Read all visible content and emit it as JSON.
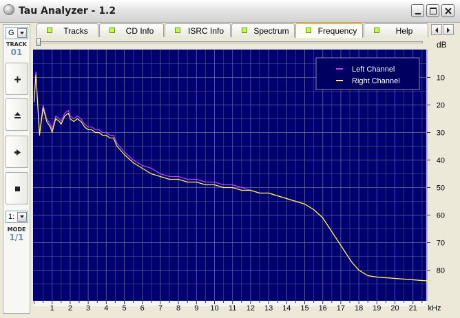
{
  "window": {
    "title": "Tau Analyzer - 1.2"
  },
  "tabs": [
    {
      "label": "Tracks",
      "active": false
    },
    {
      "label": "CD Info",
      "active": false
    },
    {
      "label": "ISRC Info",
      "active": false
    },
    {
      "label": "Spectrum",
      "active": false
    },
    {
      "label": "Frequency",
      "active": true
    },
    {
      "label": "Help",
      "active": false
    }
  ],
  "sidebar": {
    "top_combo_value": "G",
    "track_caption": "TRACK",
    "track_number": "01",
    "mode_combo_value": "1:",
    "mode_caption": "MODE",
    "mode_value": "1/1",
    "buttons": [
      "plus-icon",
      "eject-icon",
      "play-icon",
      "stop-icon"
    ]
  },
  "colors": {
    "plot_bg": "#000070",
    "grid": "#6f6f9a",
    "left_channel": "#c040ff",
    "right_channel": "#ffff40",
    "active_tab_accent": "#f2b338",
    "led": "#c4ff40"
  },
  "chart_data": {
    "type": "line",
    "xlabel": "kHz",
    "ylabel": "dB",
    "x_ticks": [
      1,
      2,
      3,
      4,
      5,
      6,
      7,
      8,
      9,
      10,
      11,
      12,
      13,
      14,
      15,
      16,
      17,
      18,
      19,
      20,
      21
    ],
    "y_ticks": [
      -10,
      -20,
      -30,
      -40,
      -50,
      -60,
      -70,
      -80
    ],
    "y_tick_labels": [
      "10",
      "20",
      "30",
      "40",
      "50",
      "60",
      "70",
      "80"
    ],
    "xlim": [
      0,
      22.05
    ],
    "ylim": [
      -89,
      0
    ],
    "grid": true,
    "legend_position": "top-right",
    "series": [
      {
        "name": "Left Channel",
        "color": "#c040ff",
        "x": [
          0.0,
          0.1,
          0.3,
          0.5,
          0.7,
          0.9,
          1.0,
          1.2,
          1.4,
          1.5,
          1.7,
          1.9,
          2.0,
          2.2,
          2.4,
          2.6,
          2.8,
          3.0,
          3.2,
          3.4,
          3.6,
          3.8,
          4.0,
          4.2,
          4.4,
          4.6,
          5.0,
          5.5,
          6.0,
          6.5,
          7.0,
          7.5,
          8.0,
          8.5,
          9.0,
          9.5,
          10.0,
          10.5,
          11.0,
          11.5,
          12.0,
          12.5,
          13.0,
          13.5,
          14.0,
          14.5,
          15.0,
          15.5,
          16.0,
          16.3,
          16.6,
          17.0,
          17.3,
          17.6,
          18.0,
          18.5,
          19.0,
          20.0,
          21.0,
          22.0
        ],
        "y": [
          -18,
          -8,
          -30,
          -20,
          -25,
          -27,
          -29,
          -24,
          -25,
          -26,
          -23,
          -22,
          -24,
          -25,
          -24,
          -25,
          -27,
          -28,
          -28,
          -29,
          -29,
          -30,
          -30,
          -31,
          -31,
          -34,
          -37,
          -40,
          -42,
          -43,
          -45,
          -46,
          -46,
          -47,
          -47,
          -48,
          -48,
          -49,
          -49,
          -50,
          -51,
          -52,
          -52,
          -53,
          -54,
          -55,
          -56,
          -58,
          -61,
          -64,
          -67,
          -71,
          -74,
          -77,
          -80,
          -82,
          -82.5,
          -83,
          -83.5,
          -84
        ]
      },
      {
        "name": "Right Channel",
        "color": "#ffff40",
        "x": [
          0.0,
          0.1,
          0.3,
          0.5,
          0.7,
          0.9,
          1.0,
          1.2,
          1.4,
          1.5,
          1.7,
          1.9,
          2.0,
          2.2,
          2.4,
          2.6,
          2.8,
          3.0,
          3.2,
          3.4,
          3.6,
          3.8,
          4.0,
          4.2,
          4.4,
          4.6,
          5.0,
          5.5,
          6.0,
          6.5,
          7.0,
          7.5,
          8.0,
          8.5,
          9.0,
          9.5,
          10.0,
          10.5,
          11.0,
          11.5,
          12.0,
          12.5,
          13.0,
          13.5,
          14.0,
          14.5,
          15.0,
          15.5,
          16.0,
          16.3,
          16.6,
          17.0,
          17.3,
          17.6,
          18.0,
          18.5,
          19.0,
          20.0,
          21.0,
          22.0
        ],
        "y": [
          -19,
          -9,
          -31,
          -21,
          -26,
          -28,
          -30,
          -25,
          -26,
          -27,
          -24,
          -23,
          -25,
          -26,
          -25,
          -26,
          -28,
          -29,
          -29,
          -30,
          -30,
          -31,
          -31,
          -32,
          -32,
          -35,
          -38,
          -41,
          -43,
          -45,
          -46,
          -47,
          -47,
          -48,
          -48,
          -49,
          -49,
          -50,
          -50,
          -51,
          -51,
          -52,
          -52,
          -53,
          -54,
          -55,
          -56,
          -58,
          -61,
          -64,
          -67,
          -71,
          -74,
          -77,
          -80,
          -82,
          -82.5,
          -83,
          -83.5,
          -84
        ]
      }
    ]
  }
}
